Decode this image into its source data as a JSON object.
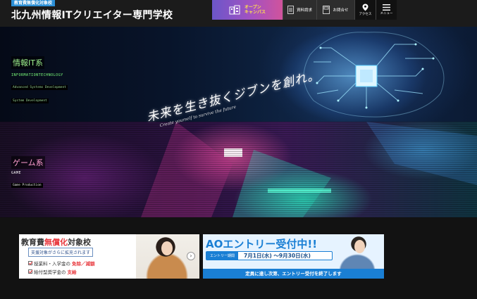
{
  "header": {
    "badge": "教育費無償化対象校",
    "school_name": "北九州情報ITクリエイター専門学校",
    "nav": {
      "open_campus": "オープン\nキャンパス",
      "request_docs": "資料請求",
      "inquiry": "お問合せ",
      "access": "アクセス",
      "menu": "メニュー"
    }
  },
  "hero": {
    "it": {
      "title": "情報IT系",
      "en": "INFORMATIONTECHNOLOGY",
      "subs": [
        "Advanced Systems Development",
        "System Development"
      ]
    },
    "game": {
      "title": "ゲーム系",
      "en": "GAME",
      "subs": [
        "Game Production"
      ]
    },
    "catchphrase": "未来を生き抜くジブンを創れ。",
    "catchphrase_en": "Create yourself to survive the future"
  },
  "banners": {
    "tuition": {
      "title_pre": "教育費",
      "title_hl": "無償化",
      "title_post": "対象校",
      "box": "支援対象がさらに拡充されます",
      "item1_pre": "授業料・入学金の",
      "item1_hl": "免除／減額",
      "item2_pre": "給付型奨学金の",
      "item2_hl": "支給"
    },
    "ao": {
      "title": "AOエントリー受付中!!",
      "period_label": "エントリー期間",
      "period": "7月1日(水) ～9月30日(水)",
      "footer": "定員に達し次第、エントリー受付を終了します"
    }
  },
  "colors": {
    "header_bg": "#1b1b1b",
    "badge": "#2b8fd6",
    "accent_red": "#e8383d",
    "ao_blue": "#1a7fd4"
  }
}
